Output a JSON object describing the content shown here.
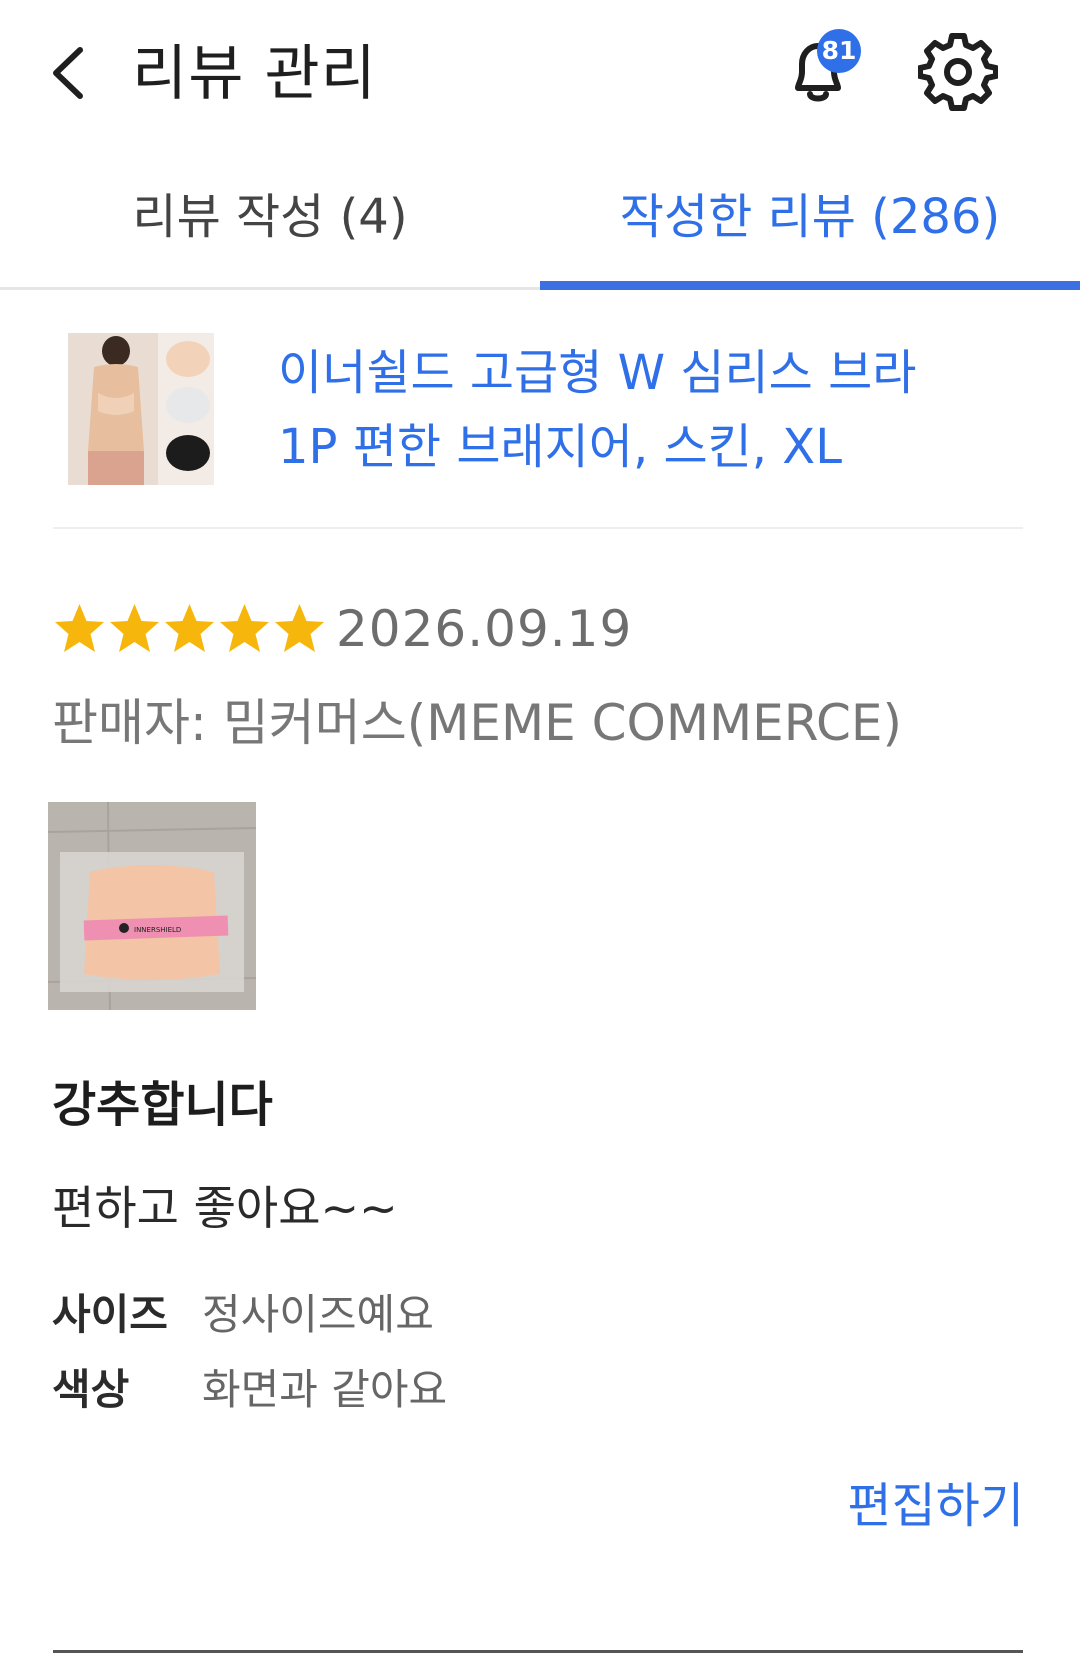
{
  "header": {
    "title": "리뷰 관리",
    "back_icon": "chevron-left-icon",
    "notification_icon": "bell-icon",
    "notification_count": "81",
    "settings_icon": "gear-icon"
  },
  "tabs": [
    {
      "label": "리뷰 작성 (4)",
      "active": false
    },
    {
      "label": "작성한 리뷰 (286)",
      "active": true
    }
  ],
  "product": {
    "name_line1": "이너쉴드 고급형 W 심리스 브라",
    "name_line2": "1P 편한 브래지어, 스킨, XL"
  },
  "review": {
    "rating": 5,
    "rating_max": 5,
    "date": "2026.09.19",
    "seller": "판매자: 밈커머스(MEME COMMERCE)",
    "headline": "강추합니다",
    "body": "편하고 좋아요~~",
    "attributes": [
      {
        "key": "사이즈",
        "value": "정사이즈예요"
      },
      {
        "key": "색상",
        "value": "화면과 같아요"
      }
    ],
    "photo_brand_text": "INNERSHIELD",
    "edit_label": "편집하기"
  },
  "colors": {
    "accent": "#2f6fe8",
    "star": "#f6b60b",
    "badge": "#2f6fe8"
  }
}
